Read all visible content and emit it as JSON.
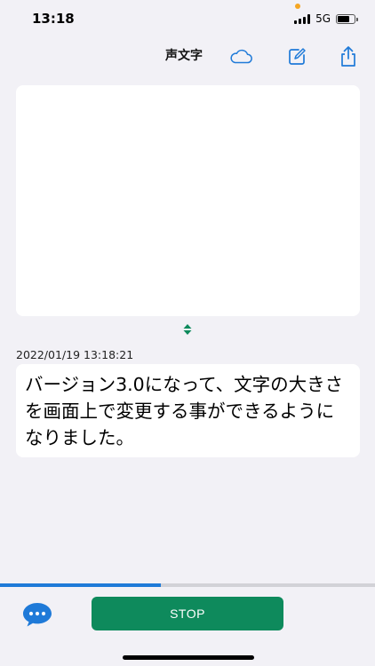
{
  "status_bar": {
    "time": "13:18",
    "network": "5G",
    "battery_level": 0.8
  },
  "nav": {
    "title": "声文字",
    "icons": [
      "cloud-icon",
      "compose-icon",
      "share-icon"
    ]
  },
  "transcript": {
    "timestamp": "2022/01/19 13:18:21",
    "text": "バージョン3.0になって、文字の大きさを画面上で変更する事ができるようになりました。"
  },
  "progress": {
    "value": 0.43,
    "color": "#1f7ad8"
  },
  "controls": {
    "stop_label": "STOP",
    "chat_icon": "speech-bubble-icon"
  },
  "colors": {
    "accent": "#0e8a5c",
    "icon_blue": "#1f7ad8",
    "background": "#f2f1f6"
  }
}
